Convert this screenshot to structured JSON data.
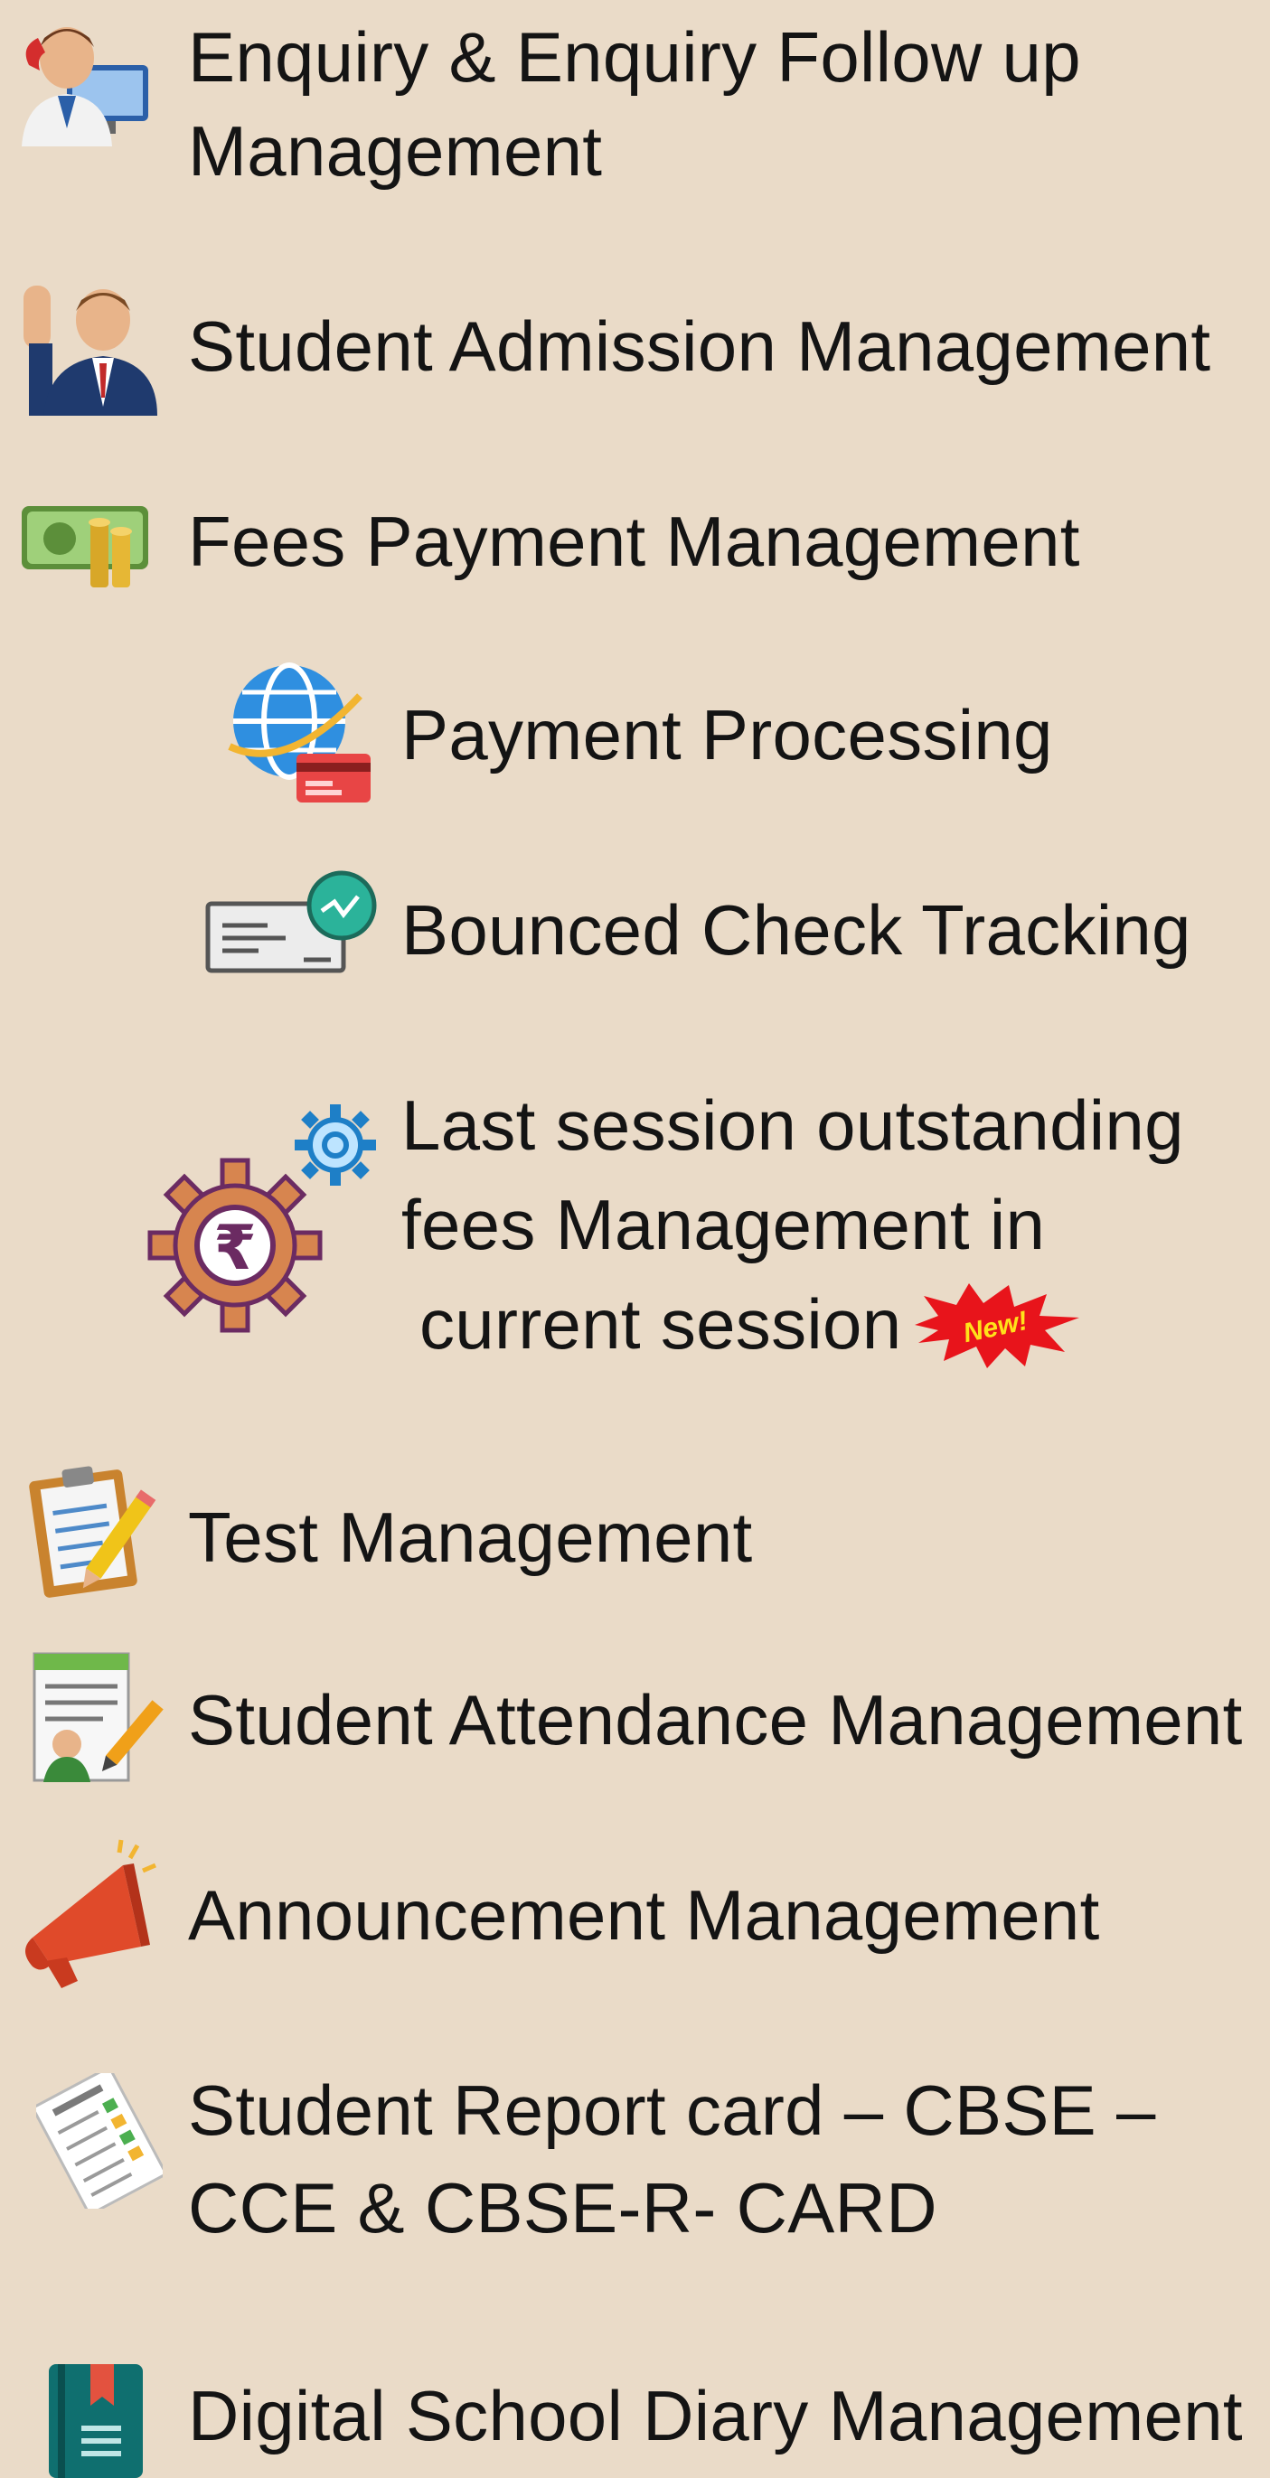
{
  "features": [
    {
      "id": "enquiry",
      "line1": "Enquiry & Enquiry Follow up",
      "line2": "Management",
      "icon": "person-phone-computer-icon"
    },
    {
      "id": "admission",
      "label": "Student Admission Management",
      "icon": "student-raising-hand-icon"
    },
    {
      "id": "fees",
      "label": "Fees Payment Management",
      "icon": "money-stack-icon"
    },
    {
      "id": "payment",
      "label": "Payment Processing",
      "icon": "globe-card-icon"
    },
    {
      "id": "bounced",
      "label": "Bounced Check Tracking",
      "icon": "check-tracking-icon"
    },
    {
      "id": "outstanding",
      "line1": "Last session outstanding",
      "line2": "fees Management in",
      "line3": "current session",
      "icon": "rupee-gear-icon",
      "badge": "New!"
    },
    {
      "id": "test",
      "label": "Test Management",
      "icon": "clipboard-pencil-icon"
    },
    {
      "id": "attendance",
      "label": "Student Attendance Management",
      "icon": "attendance-sheet-icon"
    },
    {
      "id": "announcement",
      "label": "Announcement Management",
      "icon": "megaphone-icon"
    },
    {
      "id": "reportcard",
      "line1": "Student Report card – CBSE –",
      "line2": "CCE &  CBSE-R- CARD",
      "icon": "report-card-icon"
    },
    {
      "id": "diary",
      "label": "Digital School Diary Management",
      "icon": "diary-book-icon"
    }
  ]
}
